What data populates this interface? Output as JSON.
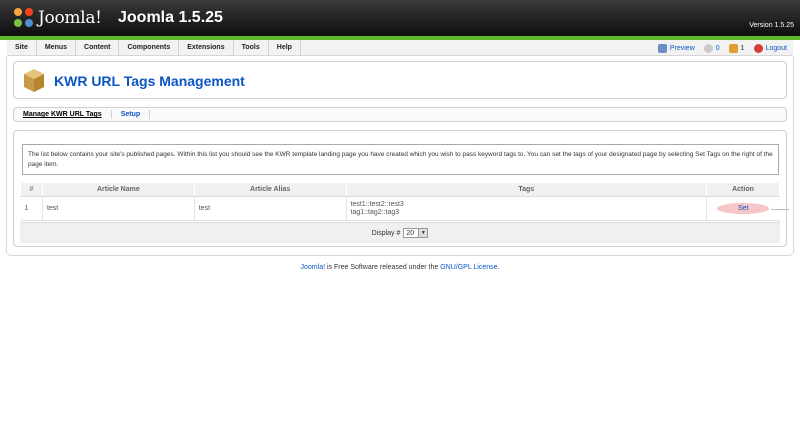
{
  "header": {
    "logo_text": "Joomla!",
    "product_title": "Joomla 1.5.25",
    "version_label": "Version 1.5.25"
  },
  "menu": {
    "items": [
      "Site",
      "Menus",
      "Content",
      "Components",
      "Extensions",
      "Tools",
      "Help"
    ]
  },
  "status": {
    "preview_label": "Preview",
    "messages_count": "0",
    "users_count": "1",
    "logout_label": "Logout"
  },
  "page": {
    "title": "KWR URL Tags Management"
  },
  "submenu": {
    "items": [
      {
        "label": "Manage KWR URL Tags",
        "active": true
      },
      {
        "label": "Setup",
        "active": false
      }
    ]
  },
  "description": "The list below contains your site's published pages. Within this list you should see the KWR template landing page you have created which you wish to pass keyword tags to. You can set the tags of your designated page by selecting Set Tags on the right of the page item.",
  "table": {
    "columns": [
      "#",
      "Article Name",
      "Article Alias",
      "Tags",
      "Action"
    ],
    "rows": [
      {
        "num": "1",
        "name": "test",
        "alias": "test",
        "tags_line1": "test1::test2::test3",
        "tags_line2": "tag1::tag2::tag3",
        "action": "Set"
      }
    ],
    "display_label": "Display #",
    "display_value": "20"
  },
  "footer": {
    "joomla_link": "Joomla!",
    "middle_text": " is Free Software released under the ",
    "license_link": "GNU/GPL License",
    "end_text": "."
  },
  "colors": {
    "link_blue": "#0b55c4",
    "accent_green": "#5fb82a",
    "set_button_bg": "#f7c6c6"
  }
}
